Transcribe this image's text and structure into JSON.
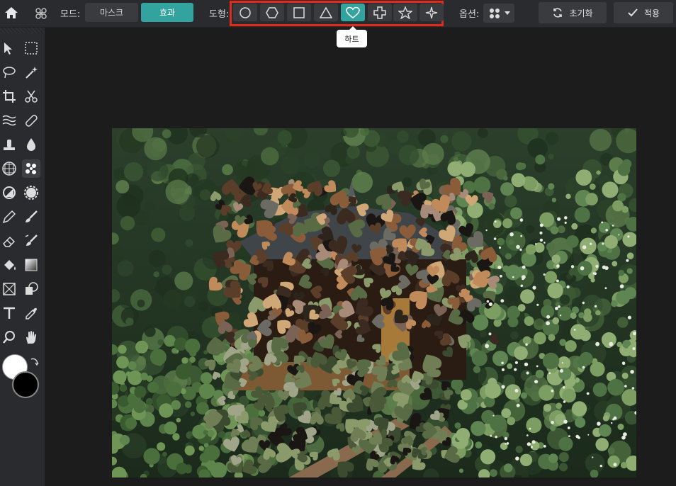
{
  "topbar": {
    "mode_label": "모드:",
    "mode_options": [
      "마스크",
      "효과"
    ],
    "mode_selected": "효과",
    "shape_label": "도형:",
    "shapes": [
      "circle-icon",
      "hexagon-icon",
      "square-icon",
      "triangle-icon",
      "heart-icon",
      "cross-icon",
      "star-icon",
      "sparkle-icon"
    ],
    "shape_selected": "heart-icon",
    "tooltip": "하트",
    "options_label": "옵션:",
    "reset_label": "초기화",
    "apply_label": "적용"
  },
  "colors": {
    "accent": "#33a3a0",
    "highlight_border": "#e02a1a",
    "foreground": "#ffffff",
    "background": "#000000"
  },
  "sidebar": {
    "tools": [
      "select-arrow-icon",
      "marquee-select-icon",
      "lasso-icon",
      "magic-wand-icon",
      "crop-icon",
      "scissors-icon",
      "liquify-icon",
      "healing-bandage-icon",
      "clone-stamp-icon",
      "blur-drop-icon",
      "grid-filter-icon",
      "scatter-effect-icon",
      "dodge-burn-icon",
      "sponge-icon",
      "pen-icon",
      "brush-icon",
      "eraser-icon",
      "color-replace-icon",
      "paint-bucket-icon",
      "gradient-icon",
      "frame-icon",
      "shape-tool-icon",
      "text-icon",
      "eyedropper-icon",
      "zoom-icon",
      "hand-icon"
    ],
    "active_tool": "scatter-effect-icon"
  },
  "canvas": {
    "image_alt": "pavilion-in-forest-photo"
  }
}
